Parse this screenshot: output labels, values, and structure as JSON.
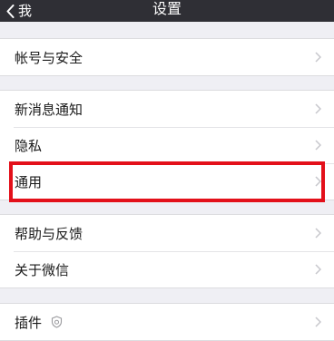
{
  "nav": {
    "back_label": "我",
    "title": "设置"
  },
  "groups": [
    {
      "items": [
        {
          "label": "帐号与安全"
        }
      ]
    },
    {
      "items": [
        {
          "label": "新消息通知"
        },
        {
          "label": "隐私"
        },
        {
          "label": "通用"
        }
      ]
    },
    {
      "items": [
        {
          "label": "帮助与反馈"
        },
        {
          "label": "关于微信"
        }
      ]
    },
    {
      "items": [
        {
          "label": "插件"
        }
      ]
    }
  ],
  "icons": {
    "back": "chevron-left-icon",
    "row_arrow": "chevron-right-icon",
    "plugin_badge": "shield-badge-icon"
  },
  "colors": {
    "nav_bar": "#2f2f35",
    "background": "#efeff4",
    "highlight": "#e3101a"
  }
}
